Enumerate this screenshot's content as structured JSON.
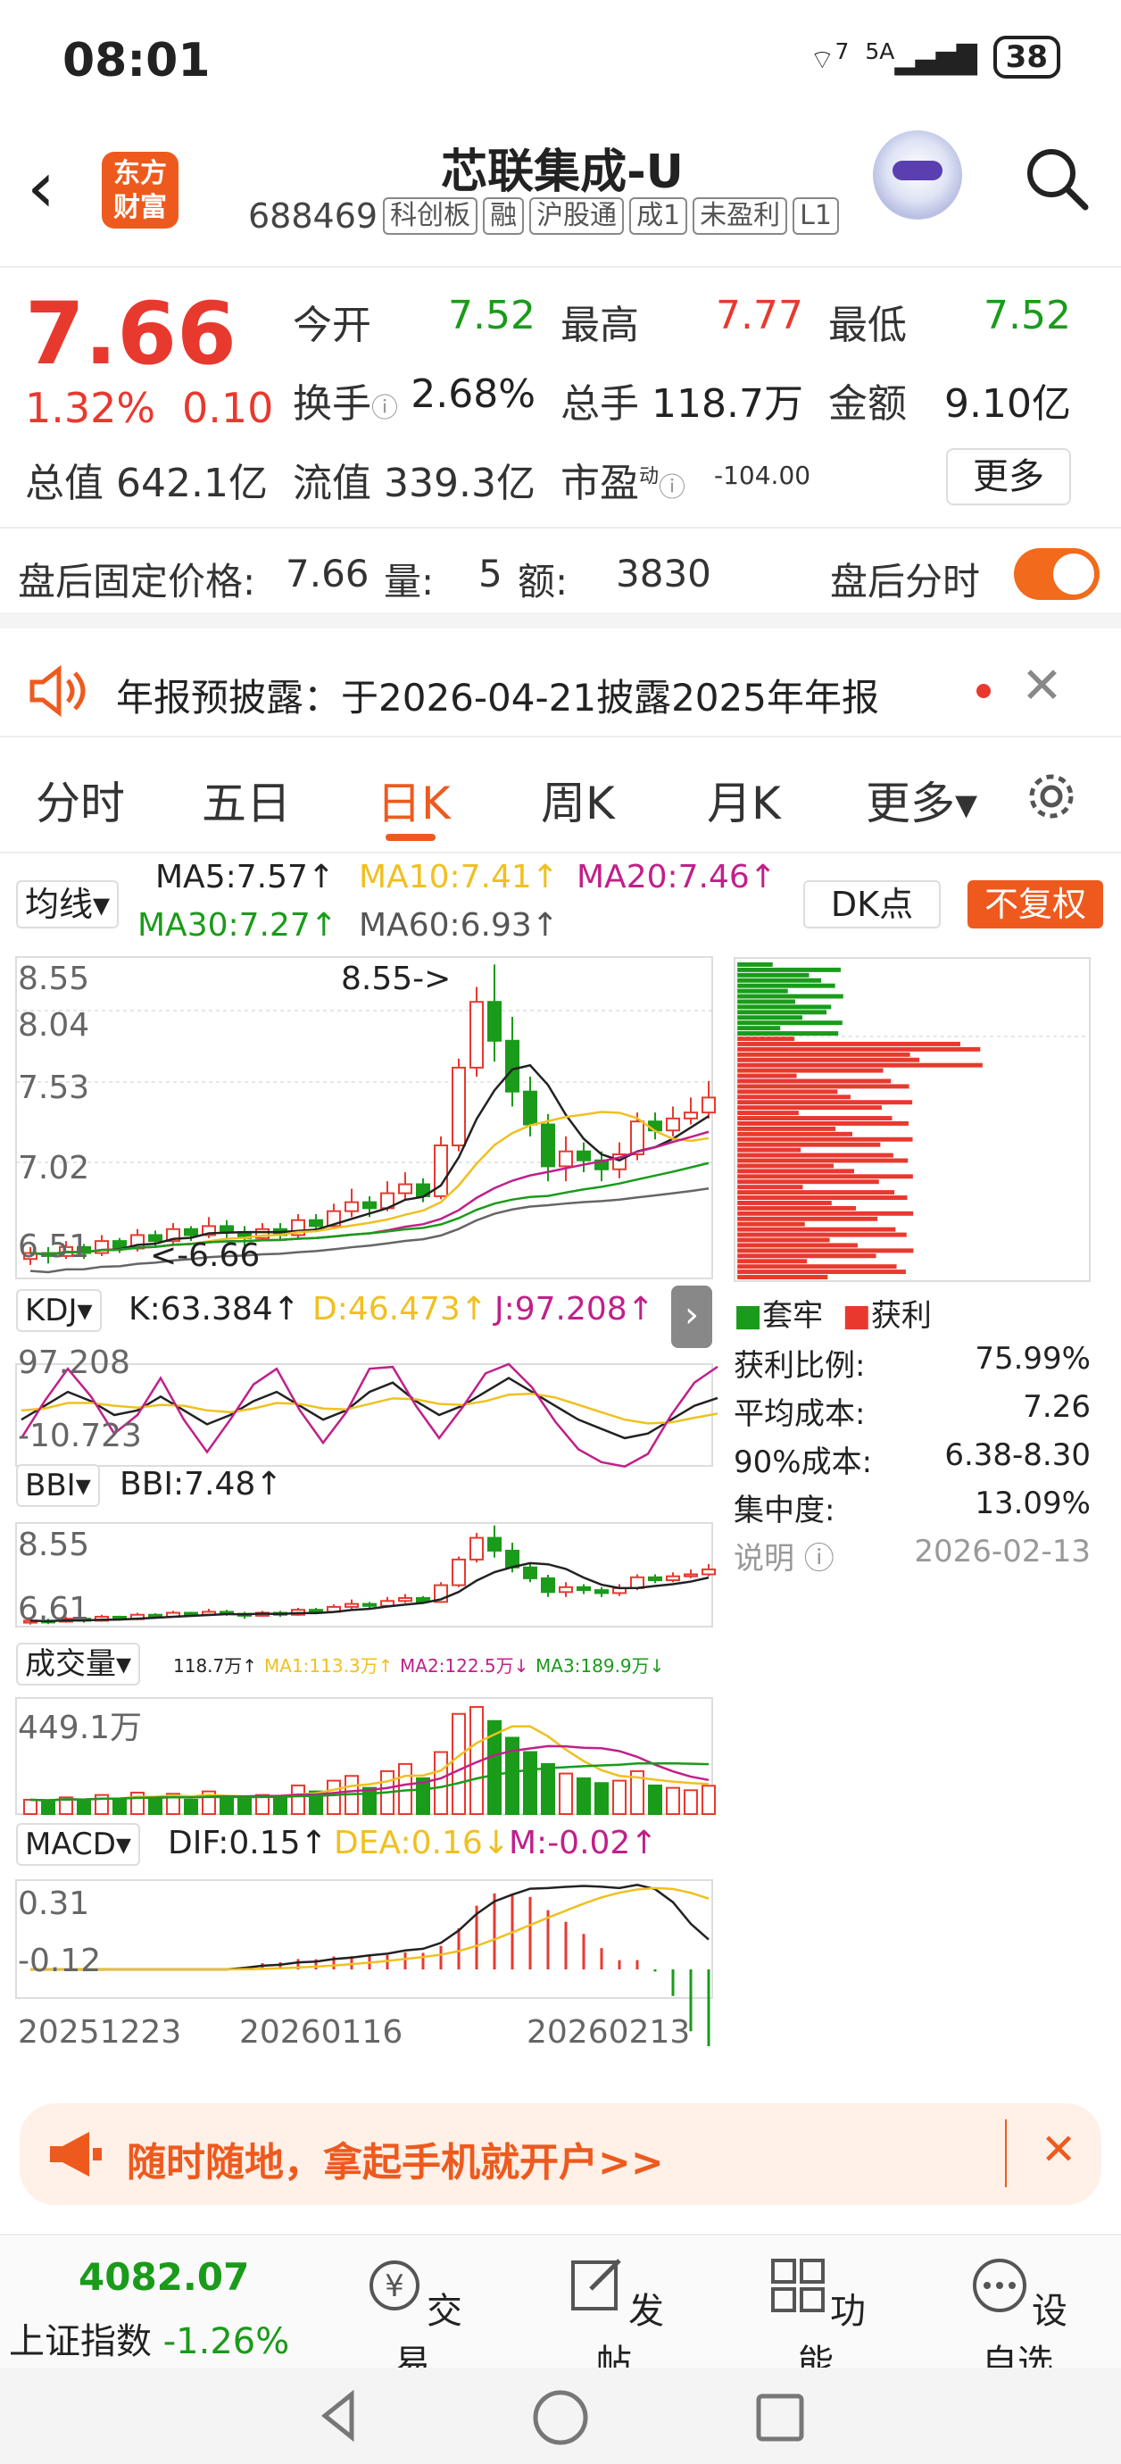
{
  "status": {
    "time": "08:01",
    "wifi": "7",
    "signal": "5A",
    "battery": "38"
  },
  "header": {
    "name": "芯联集成-U",
    "code": "688469",
    "tags": [
      "科创板",
      "融",
      "沪股通",
      "成1",
      "未盈利",
      "L1"
    ],
    "logo": "东方财富"
  },
  "quote": {
    "price": "7.66",
    "pct": "1.32%",
    "change": "0.10",
    "jinkai_l": "今开",
    "jinkai_v": "7.52",
    "zuigao_l": "最高",
    "zuigao_v": "7.77",
    "zuidi_l": "最低",
    "zuidi_v": "7.52",
    "huanshou_l": "换手",
    "huanshou_v": "2.68%",
    "zongshou_l": "总手",
    "zongshou_v": "118.7万",
    "jine_l": "金额",
    "jine_v": "9.10亿",
    "zongzhi": "总值 642.1亿",
    "liuzhi": "流值 339.3亿",
    "shiying_l": "市盈",
    "shiying_sup": "动",
    "shiying_v": "-104.00",
    "more": "更多"
  },
  "afterhours": {
    "label": "盘后固定价格:",
    "price": "7.66",
    "vol_l": "量:",
    "vol": "5",
    "amt_l": "额:",
    "amt": "3830",
    "fenshi": "盘后分时"
  },
  "notice": {
    "text": "年报预披露：于2026-04-21披露2025年年报"
  },
  "tabs": [
    "分时",
    "五日",
    "日K",
    "周K",
    "月K",
    "更多▾"
  ],
  "chart": {
    "ma_sel": "均线",
    "ma5": "MA5:7.57↑",
    "ma10": "MA10:7.41↑",
    "ma20": "MA20:7.46↑",
    "ma30": "MA30:7.27↑",
    "ma60": "MA60:6.93↑",
    "dk": "DK点",
    "fq": "不复权",
    "y1": "8.55",
    "y2": "8.04",
    "y3": "7.53",
    "y4": "7.02",
    "y5": "6.51",
    "hi": "8.55->",
    "lo": "<-6.66",
    "kdj_sel": "KDJ",
    "k": "K:63.384↑",
    "d": "D:46.473↑",
    "j": "J:97.208↑",
    "kdj_top": "97.208",
    "kdj_bot": "-10.723",
    "bbi_sel": "BBI",
    "bbi": "BBI:7.48↑",
    "bbi_top": "8.55",
    "bbi_bot": "6.61",
    "vol_sel": "成交量",
    "vol": "118.7万↑",
    "ma1": "MA1:113.3万↑",
    "ma2": "MA2:122.5万↓",
    "ma3": "MA3:189.9万↓",
    "vol_top": "449.1万",
    "macd_sel": "MACD",
    "dif": "DIF:0.15↑",
    "dea": "DEA:0.16↓",
    "m": "M:-0.02↑",
    "macd_top": "0.31",
    "macd_bot": "-0.12",
    "d1": "20251223",
    "d2": "20260116",
    "d3": "20260213"
  },
  "chip": {
    "legend_a": "套牢",
    "legend_b": "获利",
    "ratio_l": "获利比例:",
    "ratio": "75.99%",
    "cost_l": "平均成本:",
    "cost": "7.26",
    "c90_l": "90%成本:",
    "c90": "6.38-8.30",
    "conc_l": "集中度:",
    "conc": "13.09%",
    "note": "说明",
    "date": "2026-02-13"
  },
  "banner": {
    "text": "随时随地，拿起手机就开户>>"
  },
  "bottom": {
    "index": "4082.07",
    "index_name": "上证指数",
    "index_pct": "-1.26%",
    "items": [
      "交易",
      "发帖",
      "功能",
      "设自选"
    ]
  },
  "colors": {
    "up": "#e8392f",
    "down": "#1a9b1a",
    "accent": "#ee5a1e"
  },
  "candles": [
    [
      6.58,
      6.62,
      6.54,
      6.66
    ],
    [
      6.62,
      6.6,
      6.55,
      6.66
    ],
    [
      6.6,
      6.66,
      6.58,
      6.7
    ],
    [
      6.66,
      6.62,
      6.58,
      6.68
    ],
    [
      6.62,
      6.7,
      6.6,
      6.74
    ],
    [
      6.7,
      6.65,
      6.62,
      6.72
    ],
    [
      6.65,
      6.74,
      6.63,
      6.78
    ],
    [
      6.74,
      6.7,
      6.66,
      6.77
    ],
    [
      6.7,
      6.78,
      6.68,
      6.82
    ],
    [
      6.78,
      6.74,
      6.7,
      6.8
    ],
    [
      6.74,
      6.8,
      6.72,
      6.86
    ],
    [
      6.8,
      6.76,
      6.72,
      6.84
    ],
    [
      6.76,
      6.72,
      6.66,
      6.8
    ],
    [
      6.72,
      6.78,
      6.7,
      6.82
    ],
    [
      6.78,
      6.74,
      6.7,
      6.82
    ],
    [
      6.74,
      6.84,
      6.72,
      6.88
    ],
    [
      6.84,
      6.8,
      6.76,
      6.88
    ],
    [
      6.8,
      6.9,
      6.78,
      6.95
    ],
    [
      6.9,
      6.96,
      6.86,
      7.05
    ],
    [
      6.96,
      6.92,
      6.86,
      7.0
    ],
    [
      6.92,
      7.02,
      6.9,
      7.1
    ],
    [
      7.02,
      7.08,
      6.98,
      7.16
    ],
    [
      7.08,
      7.0,
      6.96,
      7.12
    ],
    [
      7.0,
      7.34,
      6.98,
      7.4
    ],
    [
      7.34,
      7.86,
      7.3,
      7.92
    ],
    [
      7.86,
      8.3,
      7.8,
      8.4
    ],
    [
      8.3,
      8.04,
      7.9,
      8.55
    ],
    [
      8.04,
      7.7,
      7.6,
      8.2
    ],
    [
      7.7,
      7.48,
      7.4,
      7.8
    ],
    [
      7.48,
      7.2,
      7.1,
      7.55
    ],
    [
      7.2,
      7.3,
      7.1,
      7.4
    ],
    [
      7.3,
      7.24,
      7.16,
      7.36
    ],
    [
      7.24,
      7.18,
      7.1,
      7.3
    ],
    [
      7.18,
      7.28,
      7.12,
      7.36
    ],
    [
      7.28,
      7.5,
      7.24,
      7.56
    ],
    [
      7.5,
      7.44,
      7.38,
      7.56
    ],
    [
      7.44,
      7.52,
      7.4,
      7.6
    ],
    [
      7.52,
      7.56,
      7.48,
      7.66
    ],
    [
      7.56,
      7.66,
      7.52,
      7.77
    ]
  ],
  "volumes": [
    60,
    55,
    70,
    58,
    80,
    65,
    90,
    72,
    85,
    60,
    95,
    70,
    65,
    80,
    75,
    120,
    95,
    140,
    160,
    110,
    180,
    210,
    150,
    260,
    420,
    449,
    390,
    320,
    260,
    210,
    170,
    150,
    130,
    140,
    180,
    120,
    110,
    100,
    118.7
  ],
  "kdj": {
    "k": [
      40,
      55,
      70,
      60,
      45,
      50,
      65,
      50,
      35,
      45,
      60,
      70,
      55,
      40,
      50,
      70,
      80,
      60,
      45,
      55,
      70,
      85,
      70,
      55,
      40,
      30,
      20,
      25,
      40,
      55,
      63.4
    ],
    "d": [
      50,
      52,
      58,
      58,
      55,
      53,
      56,
      55,
      50,
      48,
      52,
      58,
      57,
      52,
      51,
      57,
      63,
      62,
      57,
      56,
      60,
      67,
      68,
      64,
      56,
      48,
      40,
      36,
      37,
      42,
      46.5
    ],
    "j": [
      20,
      60,
      95,
      65,
      25,
      45,
      85,
      40,
      5,
      40,
      78,
      95,
      50,
      15,
      48,
      95,
      97,
      55,
      20,
      53,
      90,
      100,
      75,
      38,
      8,
      -6,
      -10.7,
      3,
      45,
      80,
      97.2
    ]
  }
}
